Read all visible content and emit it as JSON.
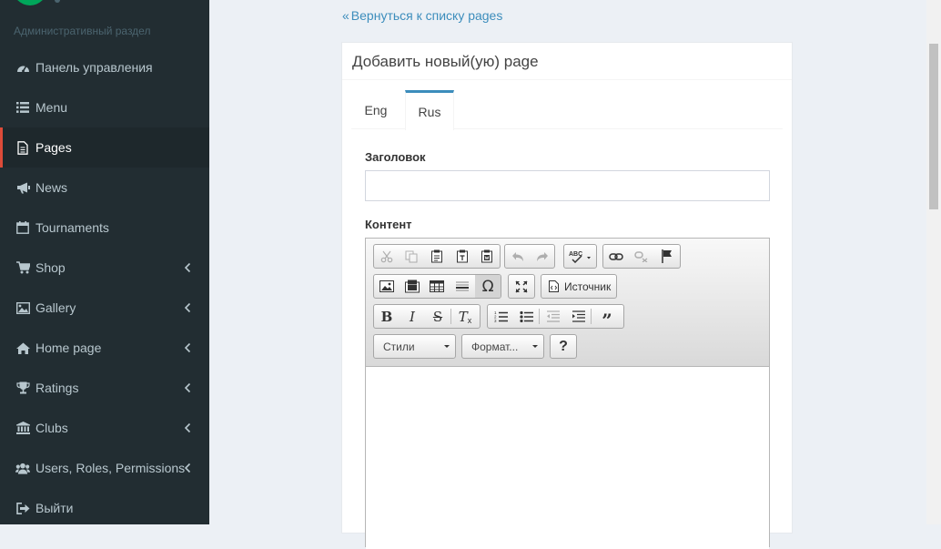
{
  "sidebar": {
    "header": "Административный раздел",
    "items": [
      {
        "label": "Панель управления",
        "icon": "dashboard-icon",
        "has_children": false,
        "active": false
      },
      {
        "label": "Menu",
        "icon": "list-icon",
        "has_children": false,
        "active": false
      },
      {
        "label": "Pages",
        "icon": "file-icon",
        "has_children": false,
        "active": true
      },
      {
        "label": "News",
        "icon": "bullhorn-icon",
        "has_children": false,
        "active": false
      },
      {
        "label": "Tournaments",
        "icon": "calendar-icon",
        "has_children": false,
        "active": false
      },
      {
        "label": "Shop",
        "icon": "shopping-cart-icon",
        "has_children": true,
        "active": false
      },
      {
        "label": "Gallery",
        "icon": "image-icon",
        "has_children": true,
        "active": false
      },
      {
        "label": "Home page",
        "icon": "home-icon",
        "has_children": true,
        "active": false
      },
      {
        "label": "Ratings",
        "icon": "trophy-icon",
        "has_children": true,
        "active": false
      },
      {
        "label": "Clubs",
        "icon": "institution-icon",
        "has_children": true,
        "active": false
      },
      {
        "label": "Users, Roles, Permissions",
        "icon": "users-icon",
        "has_children": true,
        "active": false
      },
      {
        "label": "Выйти",
        "icon": "sign-out-icon",
        "has_children": false,
        "active": false
      }
    ]
  },
  "back_link": {
    "arrow": "«",
    "label": "Вернуться к списку pages"
  },
  "box": {
    "title": "Добавить новый(ую) page",
    "tabs": [
      {
        "label": "Eng",
        "active": false
      },
      {
        "label": "Rus",
        "active": true
      }
    ],
    "fields": {
      "title_label": "Заголовок",
      "title_value": "",
      "content_label": "Контент"
    },
    "editor": {
      "source_label": "Источник",
      "styles_label": "Стили",
      "format_label": "Формат...",
      "help_label": "?",
      "content": ""
    }
  },
  "colors": {
    "sidebar_bg": "#222d32",
    "sidebar_active_border": "#dd4b39",
    "accent": "#3c8dbc",
    "logo": "#00a65a"
  }
}
